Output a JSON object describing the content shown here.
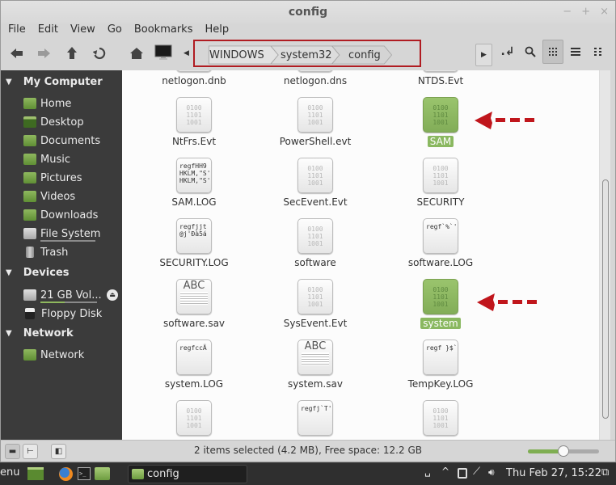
{
  "window": {
    "title": "config",
    "controls": {
      "minimize": "−",
      "maximize": "+",
      "close": "×"
    }
  },
  "menu": [
    "File",
    "Edit",
    "View",
    "Go",
    "Bookmarks",
    "Help"
  ],
  "toolbar": {
    "back_icon": "arrow-left-icon",
    "forward_icon": "arrow-right-icon",
    "up_icon": "arrow-up-icon",
    "reload_icon": "reload-icon",
    "home_icon": "home-icon",
    "computer_icon": "computer-icon",
    "breadcrumbs": [
      "WINDOWS",
      "system32",
      "config"
    ],
    "view_modes": [
      "icon-view",
      "list-view",
      "compact-view"
    ],
    "active_view": "icon-view"
  },
  "sidebar": {
    "sections": [
      {
        "title": "My Computer",
        "items": [
          {
            "label": "Home",
            "icon": "home-folder-icon"
          },
          {
            "label": "Desktop",
            "icon": "desktop-icon"
          },
          {
            "label": "Documents",
            "icon": "documents-folder-icon"
          },
          {
            "label": "Music",
            "icon": "music-folder-icon"
          },
          {
            "label": "Pictures",
            "icon": "pictures-folder-icon"
          },
          {
            "label": "Videos",
            "icon": "videos-folder-icon"
          },
          {
            "label": "Downloads",
            "icon": "downloads-folder-icon"
          },
          {
            "label": "File System",
            "icon": "drive-icon"
          },
          {
            "label": "Trash",
            "icon": "trash-icon"
          }
        ]
      },
      {
        "title": "Devices",
        "items": [
          {
            "label": "21 GB Vol...",
            "icon": "drive-icon"
          },
          {
            "label": "Floppy Disk",
            "icon": "floppy-icon"
          }
        ]
      },
      {
        "title": "Network",
        "items": [
          {
            "label": "Network",
            "icon": "network-folder-icon"
          }
        ]
      }
    ]
  },
  "files": [
    {
      "name": "netlogon.dnb",
      "type": "partial"
    },
    {
      "name": "netlogon.dns",
      "type": "partial"
    },
    {
      "name": "NTDS.Evt",
      "type": "partial"
    },
    {
      "name": "NtFrs.Evt",
      "type": "binary",
      "preview": "0100\n1101\n1001"
    },
    {
      "name": "PowerShell.evt",
      "type": "binary",
      "preview": "0100\n1101\n1001"
    },
    {
      "name": "SAM",
      "type": "binary",
      "preview": "0100\n1101\n1001",
      "selected": true
    },
    {
      "name": "SAM.LOG",
      "type": "text",
      "preview": "regfHH9\nHKLM,\"S'\nHKLM,\"S'"
    },
    {
      "name": "SecEvent.Evt",
      "type": "binary",
      "preview": "0100\n1101\n1001"
    },
    {
      "name": "SECURITY",
      "type": "binary",
      "preview": "0100\n1101\n1001"
    },
    {
      "name": "SECURITY.LOG",
      "type": "text",
      "preview": "regfjjt\n@j'Ðà5á"
    },
    {
      "name": "software",
      "type": "binary",
      "preview": "0100\n1101\n1001"
    },
    {
      "name": "software.LOG",
      "type": "text",
      "preview": "regf`%`'"
    },
    {
      "name": "software.sav",
      "type": "abc",
      "preview": "ABC"
    },
    {
      "name": "SysEvent.Evt",
      "type": "binary",
      "preview": "0100\n1101\n1001"
    },
    {
      "name": "system",
      "type": "binary",
      "preview": "0100\n1101\n1001",
      "selected": true
    },
    {
      "name": "system.LOG",
      "type": "text",
      "preview": "regfccÄ"
    },
    {
      "name": "system.sav",
      "type": "abc",
      "preview": "ABC"
    },
    {
      "name": "TempKey.LOG",
      "type": "text",
      "preview": "regf }$`"
    },
    {
      "name": "",
      "type": "binary",
      "preview": "0100\n1101\n1001"
    },
    {
      "name": "",
      "type": "text",
      "preview": "regfj`T'"
    },
    {
      "name": "",
      "type": "binary",
      "preview": "0100\n1101\n1001"
    }
  ],
  "annotations": {
    "arrow_color": "#c0161c",
    "count": 2
  },
  "statusbar": {
    "text": "2 items selected (4.2 MB), Free space: 12.2 GB",
    "zoom_level": 0.5
  },
  "taskbar": {
    "menu_label": "enu",
    "window_label": "config",
    "clock": "Thu Feb 27, 15:22"
  }
}
